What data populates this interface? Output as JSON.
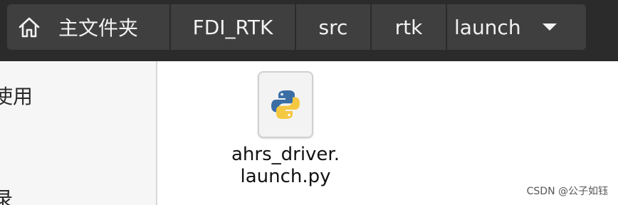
{
  "breadcrumb": {
    "items": [
      {
        "label": "主文件夹"
      },
      {
        "label": "FDI_RTK"
      },
      {
        "label": "src"
      },
      {
        "label": "rtk"
      },
      {
        "label": "launch"
      }
    ]
  },
  "sidebar": {
    "items": [
      {
        "label": "使用"
      },
      {
        "label": "录"
      }
    ]
  },
  "files": [
    {
      "name_line1": "ahrs_driver.",
      "name_line2": "launch.py",
      "icon": "python-file-icon"
    }
  ],
  "watermark": "CSDN @公子如钰",
  "colors": {
    "header_bg": "#2b2b2b",
    "crumb_bg": "#3f3f3f",
    "python_blue": "#3a6ea5",
    "python_yellow": "#f5c842"
  }
}
